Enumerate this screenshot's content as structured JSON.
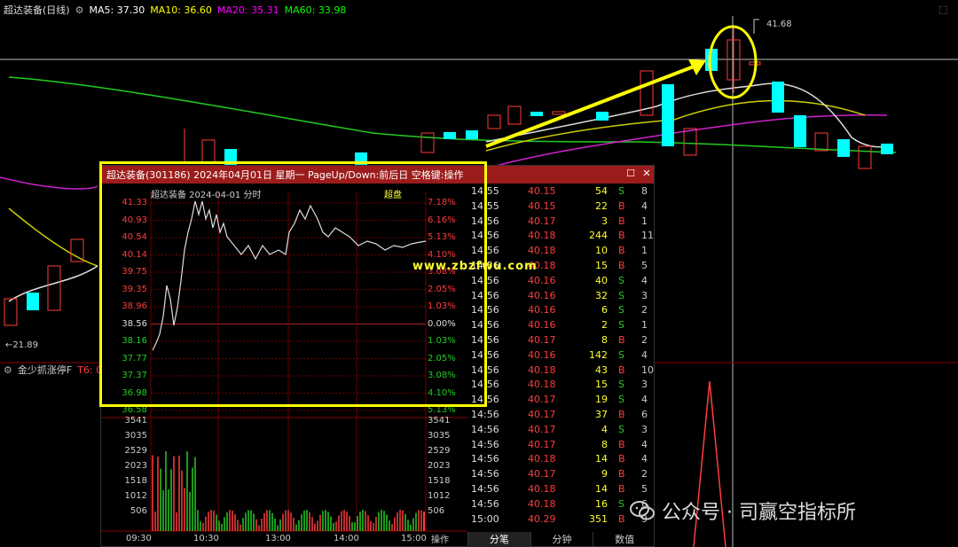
{
  "ma_header": {
    "stock": "超达装备",
    "period": "(日线)",
    "ma5_label": "MA5:",
    "ma5": "37.30",
    "ma10_label": "MA10:",
    "ma10": "36.60",
    "ma20_label": "MA20:",
    "ma20": "35.31",
    "ma60_label": "MA60:",
    "ma60": "33.98"
  },
  "colors": {
    "ma5": "#ffffff",
    "ma10": "#ffff00",
    "ma20": "#ff00ff",
    "ma60": "#00ff00",
    "up": "#ff3c3c",
    "down": "#00ffff",
    "bg": "#000000",
    "grid": "#8b0000"
  },
  "price_high": "41.68",
  "price_low": "21.89",
  "indicator": {
    "name": "金少抓涨停F",
    "value": "T6: 0"
  },
  "popup": {
    "title": "超达装备(301186) 2024年04月01日 星期一 PageUp/Down:前后日 空格键:操作",
    "mini_title": "超达装备  2024-04-01 分时",
    "mini_tag": "超盘",
    "price_axis": [
      "41.33",
      "40.93",
      "40.54",
      "40.14",
      "39.75",
      "39.35",
      "38.96",
      "38.56",
      "38.16",
      "37.77",
      "37.37",
      "36.98",
      "36.58"
    ],
    "pct_axis": [
      "7.18%",
      "6.16%",
      "5.13%",
      "4.10%",
      "3.08%",
      "2.05%",
      "1.03%",
      "0.00%",
      "1.03%",
      "2.05%",
      "3.08%",
      "4.10%",
      "5.13%"
    ],
    "vol_axis": [
      "3541",
      "3035",
      "2529",
      "2023",
      "1518",
      "1012",
      "506"
    ],
    "vol_axis_right": [
      "3541",
      "3035",
      "2529",
      "2023",
      "1518",
      "1012",
      "506"
    ],
    "time_axis": [
      "09:30",
      "10:30",
      "13:00",
      "14:00",
      "15:00"
    ],
    "ops_label": "操作",
    "tabs": [
      "分笔",
      "分钟",
      "数值"
    ],
    "ticks": [
      {
        "time": "14:55",
        "price": "40.15",
        "vol": "54",
        "bs": "S",
        "n": "8"
      },
      {
        "time": "14:55",
        "price": "40.15",
        "vol": "22",
        "bs": "B",
        "n": "4"
      },
      {
        "time": "14:56",
        "price": "40.17",
        "vol": "3",
        "bs": "B",
        "n": "1"
      },
      {
        "time": "14:56",
        "price": "40.18",
        "vol": "244",
        "bs": "B",
        "n": "11"
      },
      {
        "time": "14:56",
        "price": "40.18",
        "vol": "10",
        "bs": "B",
        "n": "1"
      },
      {
        "time": "14:56",
        "price": "40.18",
        "vol": "15",
        "bs": "B",
        "n": "5"
      },
      {
        "time": "14:56",
        "price": "40.16",
        "vol": "40",
        "bs": "S",
        "n": "4"
      },
      {
        "time": "14:56",
        "price": "40.16",
        "vol": "32",
        "bs": "S",
        "n": "3"
      },
      {
        "time": "14:56",
        "price": "40.16",
        "vol": "6",
        "bs": "S",
        "n": "2"
      },
      {
        "time": "14:56",
        "price": "40.16",
        "vol": "2",
        "bs": "S",
        "n": "1"
      },
      {
        "time": "14:56",
        "price": "40.17",
        "vol": "8",
        "bs": "B",
        "n": "2"
      },
      {
        "time": "14:56",
        "price": "40.16",
        "vol": "142",
        "bs": "S",
        "n": "4"
      },
      {
        "time": "14:56",
        "price": "40.18",
        "vol": "43",
        "bs": "B",
        "n": "10"
      },
      {
        "time": "14:56",
        "price": "40.18",
        "vol": "15",
        "bs": "S",
        "n": "3"
      },
      {
        "time": "14:56",
        "price": "40.17",
        "vol": "19",
        "bs": "S",
        "n": "4"
      },
      {
        "time": "14:56",
        "price": "40.17",
        "vol": "37",
        "bs": "B",
        "n": "6"
      },
      {
        "time": "14:56",
        "price": "40.17",
        "vol": "4",
        "bs": "S",
        "n": "3"
      },
      {
        "time": "14:56",
        "price": "40.17",
        "vol": "8",
        "bs": "B",
        "n": "4"
      },
      {
        "time": "14:56",
        "price": "40.18",
        "vol": "14",
        "bs": "B",
        "n": "4"
      },
      {
        "time": "14:56",
        "price": "40.17",
        "vol": "9",
        "bs": "B",
        "n": "2"
      },
      {
        "time": "14:56",
        "price": "40.18",
        "vol": "14",
        "bs": "B",
        "n": "5"
      },
      {
        "time": "14:56",
        "price": "40.18",
        "vol": "16",
        "bs": "S",
        "n": "6"
      },
      {
        "time": "15:00",
        "price": "40.29",
        "vol": "351",
        "bs": "B",
        "n": "9"
      }
    ]
  },
  "watermark": "www.zbzfwu.com",
  "wechat_label": "公众号 · 司赢空指标所"
}
